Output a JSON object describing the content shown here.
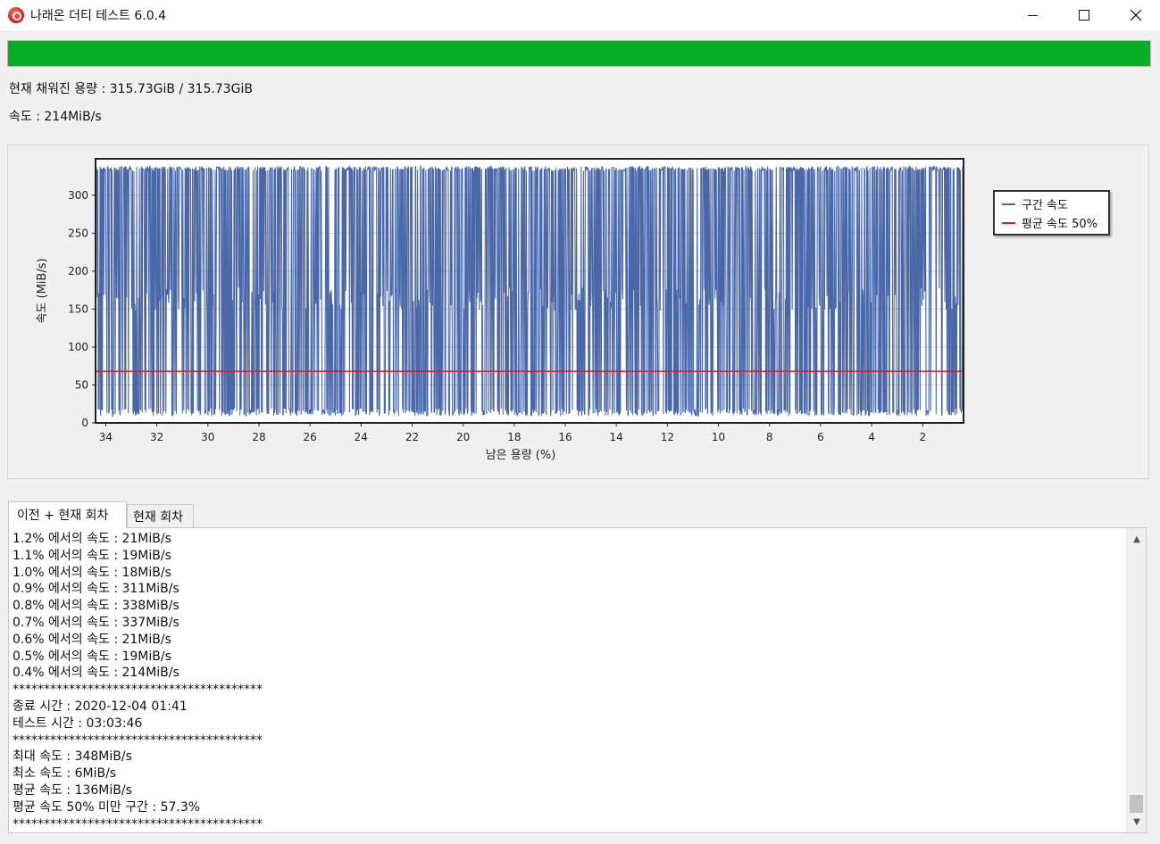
{
  "window": {
    "title": "나래온 더티 테스트 6.0.4",
    "icon": "naraeon-app-icon",
    "controls": [
      "minimize-icon",
      "maximize-icon",
      "close-icon"
    ]
  },
  "progress": {
    "value_percent": 100,
    "color": "#06b025"
  },
  "status": {
    "capacity_text": "현재 채워진 용량 : 315.73GiB / 315.73GiB",
    "speed_text": "속도 : 214MiB/s"
  },
  "chart_data": {
    "type": "line",
    "xlabel": "남은 용량 (%)",
    "ylabel": "속도 (MiB/s)",
    "x_ticks": [
      "34",
      "32",
      "30",
      "28",
      "26",
      "24",
      "22",
      "20",
      "18",
      "16",
      "14",
      "12",
      "10",
      "8",
      "6",
      "4",
      "2"
    ],
    "y_ticks": [
      "0",
      "50",
      "100",
      "150",
      "200",
      "250",
      "300"
    ],
    "xlim": [
      34.4,
      0.4
    ],
    "ylim": [
      0,
      348
    ],
    "grid": true,
    "legend_position": "right",
    "series": [
      {
        "name": "구간 속도",
        "color": "#4a68a8",
        "description_levels": {
          "high": 338,
          "mid": 178,
          "low": 19
        },
        "points_sampled": [
          {
            "x": 34.4,
            "y": 338
          },
          {
            "x": 34.3,
            "y": 160
          },
          {
            "x": 34.2,
            "y": 21
          },
          {
            "x": 33.0,
            "y": 178
          },
          {
            "x": 32.0,
            "y": 19
          },
          {
            "x": 31.0,
            "y": 311
          },
          {
            "x": 30.0,
            "y": 178
          },
          {
            "x": 29.0,
            "y": 21
          },
          {
            "x": 28.0,
            "y": 337
          },
          {
            "x": 27.0,
            "y": 178
          },
          {
            "x": 26.0,
            "y": 18
          },
          {
            "x": 25.0,
            "y": 338
          },
          {
            "x": 24.0,
            "y": 178
          },
          {
            "x": 23.0,
            "y": 19
          },
          {
            "x": 22.0,
            "y": 337
          },
          {
            "x": 21.0,
            "y": 178
          },
          {
            "x": 20.0,
            "y": 21
          },
          {
            "x": 19.0,
            "y": 338
          },
          {
            "x": 18.0,
            "y": 178
          },
          {
            "x": 17.0,
            "y": 19
          },
          {
            "x": 16.0,
            "y": 311
          },
          {
            "x": 15.0,
            "y": 178
          },
          {
            "x": 14.0,
            "y": 18
          },
          {
            "x": 13.0,
            "y": 338
          },
          {
            "x": 12.0,
            "y": 178
          },
          {
            "x": 11.0,
            "y": 19
          },
          {
            "x": 10.0,
            "y": 337
          },
          {
            "x": 9.0,
            "y": 178
          },
          {
            "x": 8.0,
            "y": 21
          },
          {
            "x": 7.0,
            "y": 338
          },
          {
            "x": 6.0,
            "y": 178
          },
          {
            "x": 5.0,
            "y": 19
          },
          {
            "x": 4.0,
            "y": 337
          },
          {
            "x": 3.0,
            "y": 178
          },
          {
            "x": 2.0,
            "y": 21
          },
          {
            "x": 1.2,
            "y": 21
          },
          {
            "x": 1.1,
            "y": 19
          },
          {
            "x": 1.0,
            "y": 18
          },
          {
            "x": 0.9,
            "y": 311
          },
          {
            "x": 0.8,
            "y": 338
          },
          {
            "x": 0.7,
            "y": 337
          },
          {
            "x": 0.6,
            "y": 21
          },
          {
            "x": 0.5,
            "y": 19
          },
          {
            "x": 0.4,
            "y": 214
          }
        ]
      },
      {
        "name": "평균 속도 50%",
        "color": "#d0202a",
        "constant_value": 68
      }
    ]
  },
  "tabs": [
    {
      "label": "이전 + 현재 회차",
      "active": true
    },
    {
      "label": "현재 회차",
      "active": false
    }
  ],
  "log": [
    "1.2% 에서의 속도 : 21MiB/s",
    "1.1% 에서의 속도 : 19MiB/s",
    "1.0% 에서의 속도 : 18MiB/s",
    "0.9% 에서의 속도 : 311MiB/s",
    "0.8% 에서의 속도 : 338MiB/s",
    "0.7% 에서의 속도 : 337MiB/s",
    "0.6% 에서의 속도 : 21MiB/s",
    "0.5% 에서의 속도 : 19MiB/s",
    "0.4% 에서의 속도 : 214MiB/s",
    "****************************************",
    "종료 시간 : 2020-12-04 01:41",
    "테스트 시간 : 03:03:46",
    "****************************************",
    "최대 속도 : 348MiB/s",
    "최소 속도 : 6MiB/s",
    "평균 속도 : 136MiB/s",
    "평균 속도 50% 미만 구간 : 57.3%",
    "****************************************"
  ]
}
